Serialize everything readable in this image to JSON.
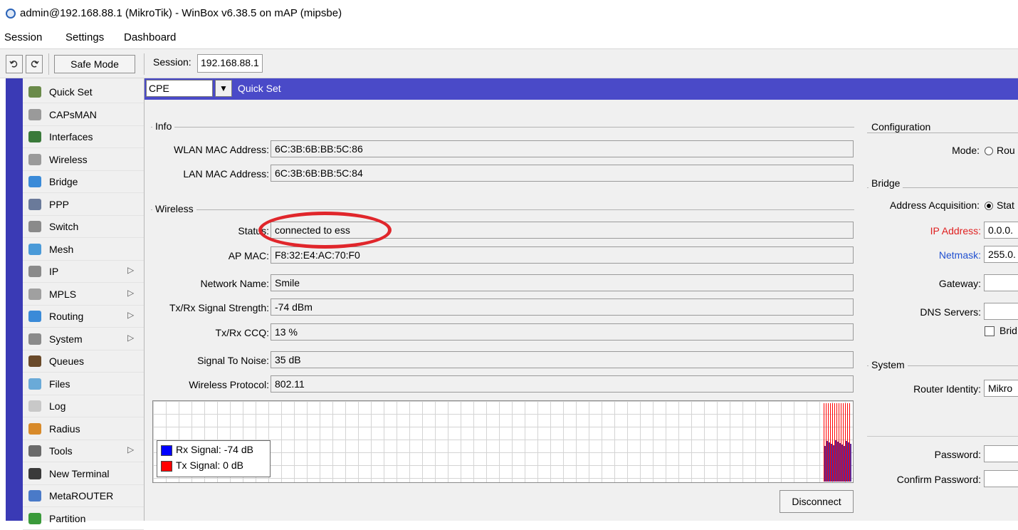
{
  "window": {
    "title": "admin@192.168.88.1 (MikroTik) - WinBox v6.38.5 on mAP (mipsbe)"
  },
  "menubar": [
    "Session",
    "Settings",
    "Dashboard"
  ],
  "toolbar": {
    "undo_icon": "undo-icon",
    "redo_icon": "redo-icon",
    "safe_mode_label": "Safe Mode",
    "session_label": "Session:",
    "session_value": "192.168.88.1"
  },
  "sidebar": {
    "items": [
      {
        "label": "Quick Set",
        "icon": "quickset-icon",
        "submenu": false,
        "color": "#6a8a4a"
      },
      {
        "label": "CAPsMAN",
        "icon": "antenna-icon",
        "submenu": false,
        "color": "#9a9a9a"
      },
      {
        "label": "Interfaces",
        "icon": "interfaces-icon",
        "submenu": false,
        "color": "#3a7a3a"
      },
      {
        "label": "Wireless",
        "icon": "antenna-icon",
        "submenu": false,
        "color": "#9a9a9a"
      },
      {
        "label": "Bridge",
        "icon": "bridge-icon",
        "submenu": false,
        "color": "#3a8ad8"
      },
      {
        "label": "PPP",
        "icon": "ppp-icon",
        "submenu": false,
        "color": "#6a7a9a"
      },
      {
        "label": "Switch",
        "icon": "switch-icon",
        "submenu": false,
        "color": "#8a8a8a"
      },
      {
        "label": "Mesh",
        "icon": "mesh-icon",
        "submenu": false,
        "color": "#4a9ad8"
      },
      {
        "label": "IP",
        "icon": "ip-icon",
        "submenu": true,
        "color": "#8a8a8a"
      },
      {
        "label": "MPLS",
        "icon": "mpls-icon",
        "submenu": true,
        "color": "#a0a0a0"
      },
      {
        "label": "Routing",
        "icon": "routing-icon",
        "submenu": true,
        "color": "#3a8ad8"
      },
      {
        "label": "System",
        "icon": "gear-icon",
        "submenu": true,
        "color": "#8a8a8a"
      },
      {
        "label": "Queues",
        "icon": "queues-icon",
        "submenu": false,
        "color": "#6a4a2a"
      },
      {
        "label": "Files",
        "icon": "folder-icon",
        "submenu": false,
        "color": "#6aaad8"
      },
      {
        "label": "Log",
        "icon": "log-icon",
        "submenu": false,
        "color": "#c8c8c8"
      },
      {
        "label": "Radius",
        "icon": "radius-icon",
        "submenu": false,
        "color": "#d88a2a"
      },
      {
        "label": "Tools",
        "icon": "tools-icon",
        "submenu": true,
        "color": "#6a6a6a"
      },
      {
        "label": "New Terminal",
        "icon": "terminal-icon",
        "submenu": false,
        "color": "#3a3a3a"
      },
      {
        "label": "MetaROUTER",
        "icon": "metarouter-icon",
        "submenu": false,
        "color": "#4a7ac8"
      },
      {
        "label": "Partition",
        "icon": "partition-icon",
        "submenu": false,
        "color": "#3a9a3a"
      }
    ]
  },
  "quickset": {
    "mode_select": "CPE",
    "window_title": "Quick Set",
    "info": {
      "group_label": "Info",
      "wlan_mac_label": "WLAN MAC Address:",
      "wlan_mac_value": "6C:3B:6B:BB:5C:86",
      "lan_mac_label": "LAN MAC Address:",
      "lan_mac_value": "6C:3B:6B:BB:5C:84"
    },
    "wireless": {
      "group_label": "Wireless",
      "fields": [
        {
          "label": "Status:",
          "value": "connected to ess"
        },
        {
          "label": "AP MAC:",
          "value": "F8:32:E4:AC:70:F0"
        },
        {
          "label": "Network Name:",
          "value": "Smile"
        },
        {
          "label": "Tx/Rx Signal Strength:",
          "value": "-74 dBm"
        },
        {
          "label": "Tx/Rx CCQ:",
          "value": "13 %"
        },
        {
          "label": "Signal To Noise:",
          "value": "35 dB"
        },
        {
          "label": "Wireless Protocol:",
          "value": "802.11"
        }
      ]
    },
    "graph": {
      "legend": [
        {
          "label": "Rx Signal:  -74 dB",
          "color": "#0000ff"
        },
        {
          "label": "Tx Signal:  0 dB",
          "color": "#ff0000"
        }
      ]
    },
    "disconnect_label": "Disconnect",
    "configuration": {
      "group_label": "Configuration",
      "mode_label": "Mode:",
      "mode_option": "Rou"
    },
    "bridge": {
      "group_label": "Bridge",
      "addr_acq_label": "Address Acquisition:",
      "addr_acq_option": "Stat",
      "ip_label": "IP Address:",
      "ip_value": "0.0.0.",
      "netmask_label": "Netmask:",
      "netmask_value": "255.0.",
      "gateway_label": "Gateway:",
      "dns_label": "DNS Servers:",
      "bridge_all_label": "Brid"
    },
    "system": {
      "group_label": "System",
      "identity_label": "Router Identity:",
      "identity_value": "Mikro",
      "password_label": "Password:",
      "confirm_password_label": "Confirm Password:"
    }
  },
  "colors": {
    "accent_blue": "#4a4ac8",
    "ip_label_red": "#e02020",
    "netmask_label_blue": "#2050d0",
    "annotation_red": "#e0262b",
    "bar_purple": "#5a2a9a"
  }
}
